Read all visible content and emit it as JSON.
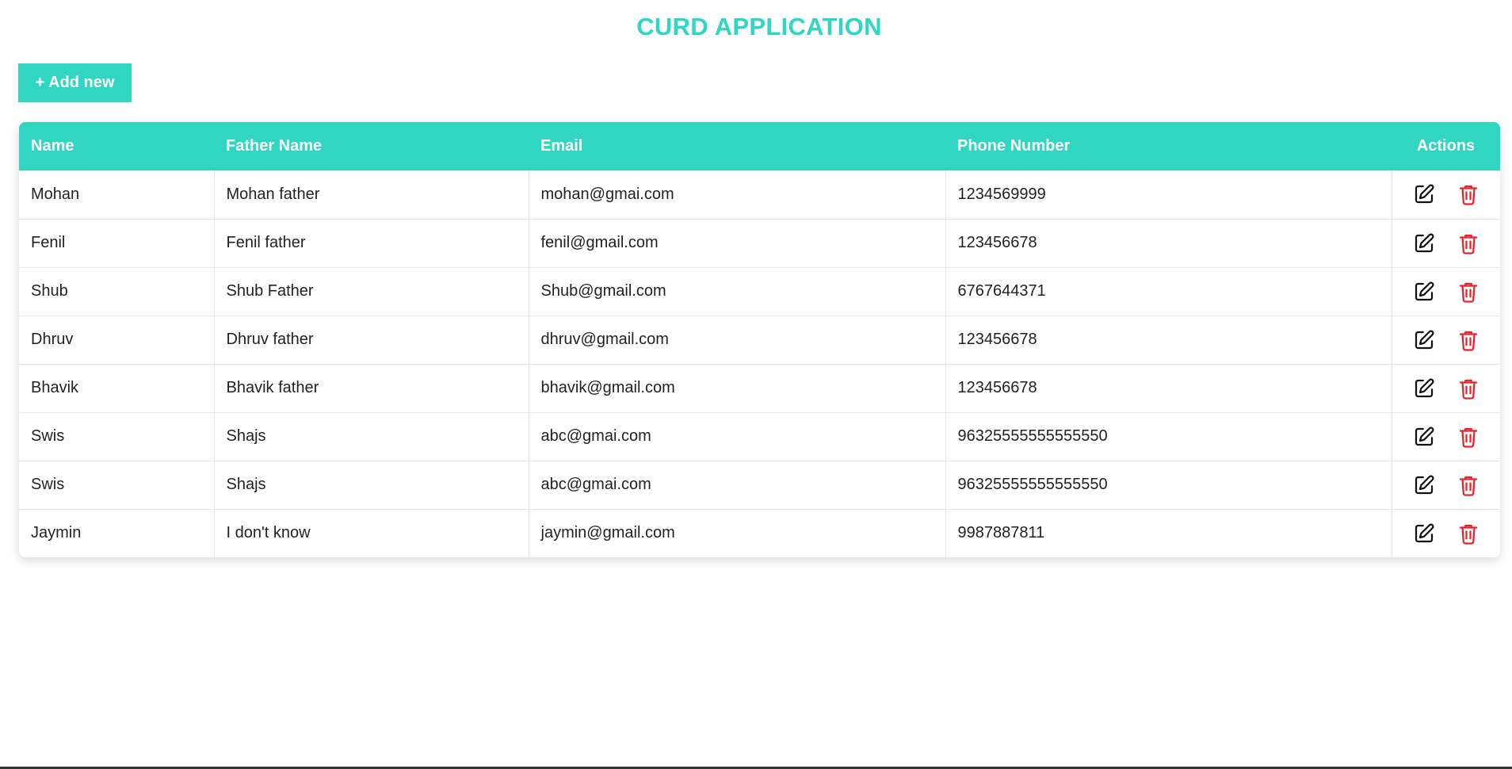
{
  "header": {
    "title": "CURD APPLICATION"
  },
  "toolbar": {
    "add_label": "+ Add new"
  },
  "table": {
    "columns": [
      "Name",
      "Father Name",
      "Email",
      "Phone Number",
      "Actions"
    ],
    "rows": [
      {
        "name": "Mohan",
        "father": "Mohan father",
        "email": "mohan@gmai.com",
        "phone": "1234569999"
      },
      {
        "name": "Fenil",
        "father": "Fenil father",
        "email": "fenil@gmail.com",
        "phone": "123456678"
      },
      {
        "name": "Shub",
        "father": "Shub Father",
        "email": "Shub@gmail.com",
        "phone": "6767644371"
      },
      {
        "name": "Dhruv",
        "father": "Dhruv father",
        "email": "dhruv@gmail.com",
        "phone": "123456678"
      },
      {
        "name": "Bhavik",
        "father": "Bhavik father",
        "email": "bhavik@gmail.com",
        "phone": "123456678"
      },
      {
        "name": "Swis",
        "father": "Shajs",
        "email": "abc@gmai.com",
        "phone": "96325555555555550"
      },
      {
        "name": "Swis",
        "father": "Shajs",
        "email": "abc@gmai.com",
        "phone": "96325555555555550"
      },
      {
        "name": "Jaymin",
        "father": "I don't know",
        "email": "jaymin@gmail.com",
        "phone": "9987887811"
      }
    ],
    "row_actions": [
      {
        "icon": "edit-icon",
        "color": "#111111"
      },
      {
        "icon": "trash-icon",
        "color": "#e8232b"
      }
    ]
  },
  "colors": {
    "accent": "#2fd6c2",
    "delete": "#e8232b"
  }
}
